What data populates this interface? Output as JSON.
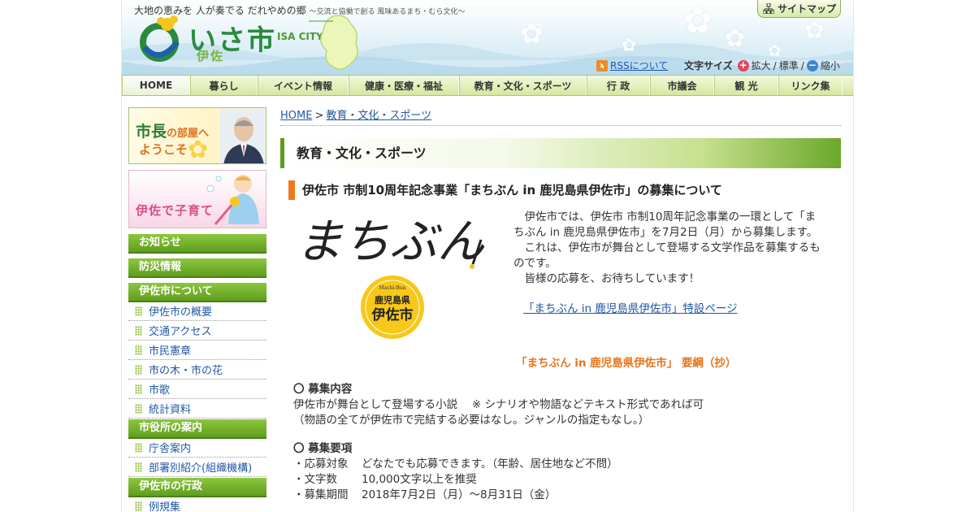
{
  "header": {
    "tagline_main": "大地の恵みを 人が奏でる だれやめの郷",
    "tagline_sub": "～交流と協働で創る 風味あるまち・むら文化～",
    "logo_text": "いさ市",
    "logo_kanji": "伊佐",
    "logo_en": "ISA CITY",
    "sitemap_label": "サイトマップ",
    "rss_link": "RSSについて",
    "font_size_label": "文字サイズ",
    "font_enlarge": "拡大",
    "font_standard": "標準",
    "font_shrink": "縮小",
    "sep1": "/",
    "sep2": "/"
  },
  "gnav": {
    "items": [
      "HOME",
      "暮らし",
      "イベント情報",
      "健康・医療・福祉",
      "教育・文化・スポーツ",
      "行 政",
      "市議会",
      "観 光",
      "リンク集"
    ]
  },
  "sidebar": {
    "mayor_banner": {
      "line1_a": "市長",
      "line1_b": "の部屋へ",
      "line2": "ようこそ"
    },
    "kids_banner": "伊佐で子育て",
    "sections": [
      {
        "heading": "お知らせ",
        "links": []
      },
      {
        "heading": "防災情報",
        "links": []
      },
      {
        "heading": "伊佐市について",
        "links": [
          "伊佐市の概要",
          "交通アクセス",
          "市民憲章",
          "市の木・市の花",
          "市歌",
          "統計資料"
        ]
      },
      {
        "heading": "市役所の案内",
        "links": [
          "庁舎案内",
          "部署別紹介(組織機構)"
        ]
      },
      {
        "heading": "伊佐市の行政",
        "links": [
          "例規集"
        ]
      }
    ]
  },
  "breadcrumb": {
    "home": "HOME",
    "separator": ">",
    "current": "教育・文化・スポーツ"
  },
  "section_title": "教育・文化・スポーツ",
  "article": {
    "title": "伊佐市 市制10周年記念事業「まちぶん in 鹿児島県伊佐市」の募集について",
    "logo_script": "まちぶん",
    "seal_top": "Machi-Bun",
    "seal_line1": "鹿児島県",
    "seal_line2": "伊佐市",
    "intro": [
      "伊佐市では、伊佐市 市制10周年記念事業の一環として「まちぶん in 鹿児島県伊佐市」を7月2日（月）から募集します。",
      "これは、伊佐市が舞台として登場する文学作品を募集するものです。",
      "皆様の応募を、お待ちしています！"
    ],
    "special_link": "「まちぶん in 鹿児島県伊佐市」特設ページ",
    "outline_heading": "「まちぶん in 鹿児島県伊佐市」 要綱（抄）",
    "recruit_content": {
      "heading": "〇 募集内容",
      "line1": "伊佐市が舞台として登場する小説　 ※ シナリオや物語などテキスト形式であれば可",
      "line2": "（物語の全てが伊佐市で完結する必要はなし。ジャンルの指定もなし。）"
    },
    "recruit_terms": {
      "heading": "〇 募集要項",
      "rows": [
        {
          "key": "・応募対象",
          "value": "どなたでも応募できます。（年齢、居住地など不問）"
        },
        {
          "key": "・文字数",
          "value": "10,000文字以上を推奨"
        },
        {
          "key": "・募集期間",
          "value": "2018年7月2日（月）～8月31日（金）"
        }
      ]
    }
  },
  "colors": {
    "nav_green": "#5f9e1e",
    "accent_orange": "#ee7b1a",
    "link_blue": "#2257a5"
  }
}
